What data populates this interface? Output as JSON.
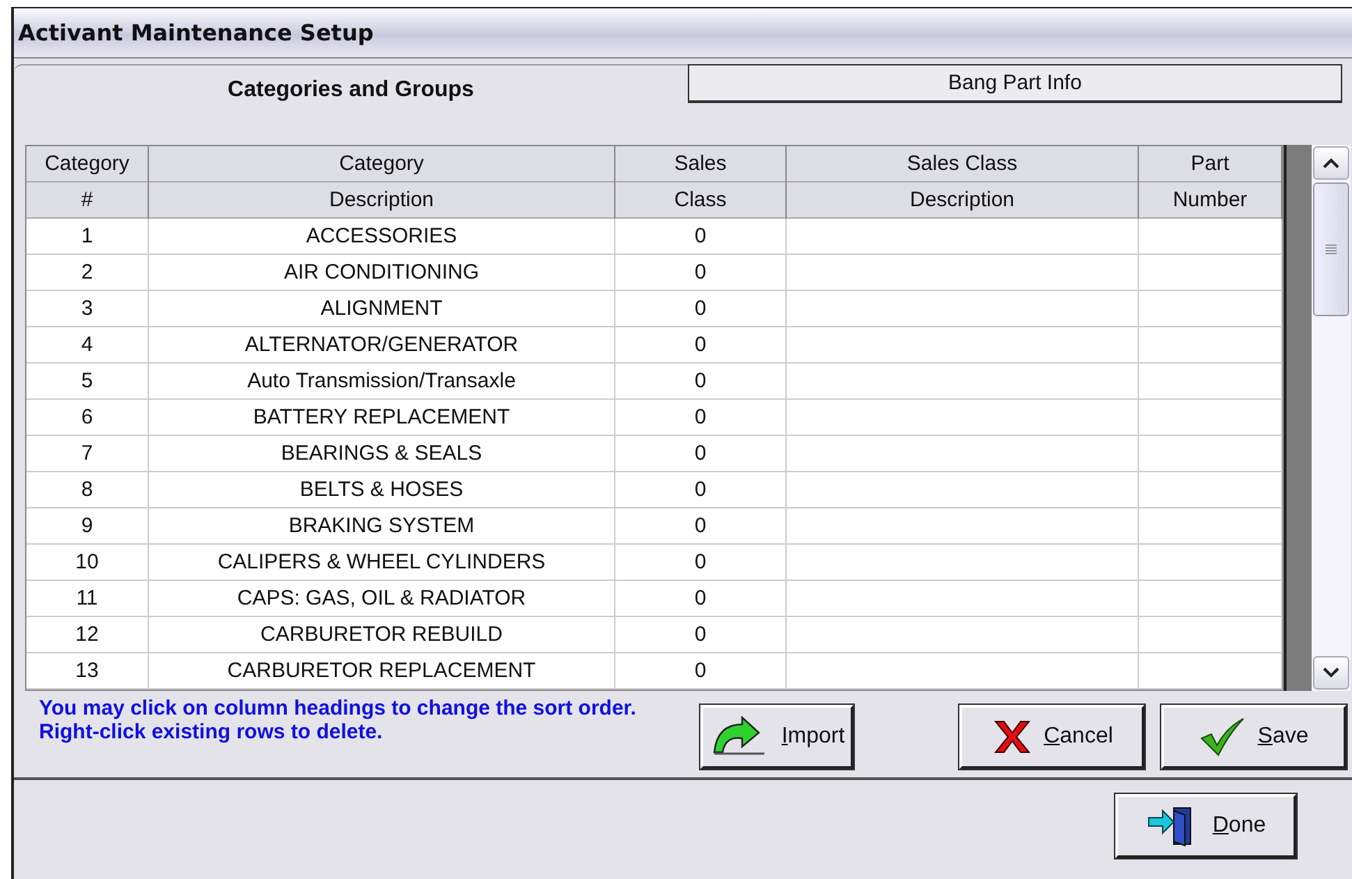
{
  "window": {
    "title": "Activant Maintenance Setup"
  },
  "tabs": [
    {
      "label": "Categories and Groups",
      "selected": true
    },
    {
      "label": "Bang Part Info",
      "selected": false
    }
  ],
  "table": {
    "columns": [
      [
        "Category",
        "#"
      ],
      [
        "Category",
        "Description"
      ],
      [
        "Sales",
        "Class"
      ],
      [
        "Sales Class",
        "Description"
      ],
      [
        "Part",
        "Number"
      ]
    ],
    "rows": [
      {
        "number": "1",
        "description": "ACCESSORIES",
        "sales_class": "0"
      },
      {
        "number": "2",
        "description": "AIR CONDITIONING",
        "sales_class": "0"
      },
      {
        "number": "3",
        "description": "ALIGNMENT",
        "sales_class": "0"
      },
      {
        "number": "4",
        "description": "ALTERNATOR/GENERATOR",
        "sales_class": "0"
      },
      {
        "number": "5",
        "description": "Auto Transmission/Transaxle",
        "sales_class": "0"
      },
      {
        "number": "6",
        "description": "BATTERY REPLACEMENT",
        "sales_class": "0"
      },
      {
        "number": "7",
        "description": "BEARINGS & SEALS",
        "sales_class": "0"
      },
      {
        "number": "8",
        "description": "BELTS & HOSES",
        "sales_class": "0"
      },
      {
        "number": "9",
        "description": "BRAKING SYSTEM",
        "sales_class": "0"
      },
      {
        "number": "10",
        "description": "CALIPERS & WHEEL CYLINDERS",
        "sales_class": "0"
      },
      {
        "number": "11",
        "description": "CAPS: GAS, OIL & RADIATOR",
        "sales_class": "0"
      },
      {
        "number": "12",
        "description": "CARBURETOR REBUILD",
        "sales_class": "0"
      },
      {
        "number": "13",
        "description": "CARBURETOR REPLACEMENT",
        "sales_class": "0"
      }
    ]
  },
  "hint": "You may click on column headings to change the sort order.  Right-click existing rows to delete.",
  "buttons": [
    {
      "kind": "import",
      "label": "Import"
    },
    {
      "kind": "cancel",
      "label": "Cancel"
    },
    {
      "kind": "save",
      "label": "Save"
    }
  ],
  "footer_buttons": [
    {
      "kind": "done",
      "label": "Done"
    }
  ]
}
